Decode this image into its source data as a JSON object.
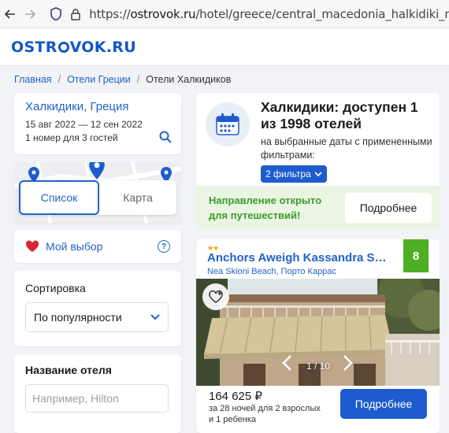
{
  "browser": {
    "url_prefix": "https://",
    "url_host": "ostrovok.ru",
    "url_path": "/hotel/greece/central_macedonia_halkidiki_neighborho"
  },
  "site": {
    "logo_left": "OSTR",
    "logo_right": "VOK.RU"
  },
  "breadcrumb": [
    "Главная",
    "Отели Греции",
    "Отели Халкидиков"
  ],
  "search": {
    "destination": "Халкидики, Греция",
    "dates": "15 авг 2022 — 12 сен 2022",
    "guests": "1 номер для 3 гостей"
  },
  "map_toggle": {
    "list": "Список",
    "map": "Карта"
  },
  "favorites": {
    "label": "Мой выбор",
    "help": "?"
  },
  "sort": {
    "title": "Сортировка",
    "selected": "По популярности"
  },
  "hotel_name_filter": {
    "title": "Название отеля",
    "placeholder": "Например, Hilton"
  },
  "availability": {
    "title": "Халкидики: доступен 1 из 1998 отелей",
    "subtitle": "на выбранные даты с примененными фильтрами:",
    "filter_pill": "2 фильтра"
  },
  "banner": {
    "text": "Направление открыто для путешествий!",
    "button": "Подробнее"
  },
  "hotel": {
    "stars": "★★",
    "name": "Anchors Aweigh Kassandra Se...",
    "location": "Nea Skioni Beach, Порто Каррас",
    "rating": "8",
    "photo_counter": "1 / 10",
    "price": "164 625 ₽",
    "price_details": "за 28 ночей для 2 взрослых и 1 ребенка",
    "button": "Подробнее"
  },
  "colors": {
    "brand_blue": "#1457c2",
    "link_blue": "#2263c7",
    "button_blue": "#1d5ccf",
    "green_text": "#3d9c2a",
    "rating_green": "#4caf24"
  }
}
